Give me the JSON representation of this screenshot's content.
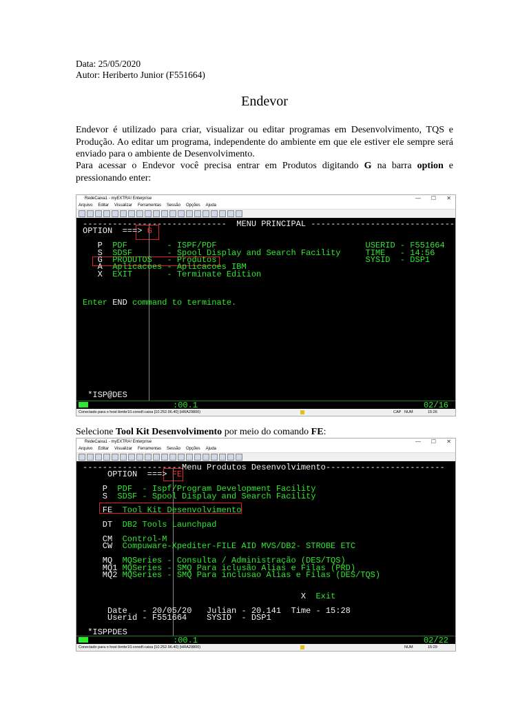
{
  "header": {
    "date": "Data: 25/05/2020",
    "author": "Autor: Heriberto Junior (F551664)"
  },
  "title": "Endevor",
  "intro": {
    "p1": "Endevor é utilizado para criar, visualizar ou editar programas em Desenvolvimento, TQS e Produção. Ao editar um programa, independente do ambiente em que ele estiver ele sempre será enviado para o ambiente de Desenvolvimento.",
    "p2_a": "Para acessar o Endevor você precisa entrar em Produtos digitando ",
    "p2_b": "G",
    "p2_c": " na barra ",
    "p2_d": "option",
    "p2_e": " e pressionando enter:"
  },
  "step2": {
    "a": "Selecione ",
    "b": "Tool Kit Desenvolvimento",
    "c": " por meio do comando ",
    "d": "FE",
    "e": ":"
  },
  "window": {
    "title": "RedeCaixa1 - myEXTRA! Enterprise",
    "menu": [
      "Arquivo",
      "Editar",
      "Visualizar",
      "Ferramentas",
      "Sessão",
      "Opções",
      "Ajuda"
    ],
    "minimize": "—",
    "maximize": "☐",
    "close": "✕"
  },
  "screen1": {
    "lines": [
      [
        [
          "-----------------------------  ",
          "w"
        ],
        [
          "MENU PRINCIPAL",
          "w"
        ],
        [
          " -----------------------------",
          "w"
        ]
      ],
      [
        [
          "OPTION  ===> ",
          "w"
        ],
        [
          "G",
          "r"
        ]
      ],
      [
        [
          "",
          "w"
        ]
      ],
      [
        [
          "   P  ",
          "w"
        ],
        [
          "PDF        - ISPF/PDF",
          "g"
        ],
        [
          "                              USERID - F551664",
          "g"
        ]
      ],
      [
        [
          "   S  ",
          "w"
        ],
        [
          "SDSF       - Spool Display and Search Facility",
          "g"
        ],
        [
          "     TIME   - 14:56",
          "g"
        ]
      ],
      [
        [
          "   G  ",
          "w"
        ],
        [
          "PRODUTOS   - Produtos",
          "g"
        ],
        [
          "                              SYSID  - DSP1",
          "g"
        ]
      ],
      [
        [
          "   A  ",
          "w"
        ],
        [
          "Aplicacoes - Aplicacoes IBM",
          "g"
        ]
      ],
      [
        [
          "   X  ",
          "w"
        ],
        [
          "EXIT       - Terminate Edition",
          "g"
        ]
      ],
      [
        [
          "",
          "w"
        ]
      ],
      [
        [
          "",
          "w"
        ]
      ],
      [
        [
          "",
          "w"
        ]
      ],
      [
        [
          "Enter ",
          "g"
        ],
        [
          "END",
          "w"
        ],
        [
          " command to terminate.",
          "g"
        ]
      ]
    ],
    "bottom_cmd": " *ISP@DES",
    "timer": ":00.1",
    "position": "02/16",
    "status_text": "Conectado para o host ibmbr10.coredf.caixa [10.252.96.40] (HRA29800)",
    "caps": "CAP",
    "num": "NUM",
    "clock": "15:26"
  },
  "screen2": {
    "lines": [
      [
        [
          "--------------------",
          "w"
        ],
        [
          "Menu Produtos Desenvolvimento",
          "w"
        ],
        [
          "------------------------",
          "w"
        ]
      ],
      [
        [
          "     OPTION  ===> ",
          "w"
        ],
        [
          "FE",
          "r"
        ]
      ],
      [
        [
          "",
          "w"
        ]
      ],
      [
        [
          "    P  ",
          "w"
        ],
        [
          "PDF  - Ispf/Program Development Facility",
          "g"
        ]
      ],
      [
        [
          "    S  ",
          "w"
        ],
        [
          "SDSF - Spool Display and Search Facility",
          "g"
        ]
      ],
      [
        [
          "",
          "w"
        ]
      ],
      [
        [
          "    FE  ",
          "w"
        ],
        [
          "Tool Kit Desenvolvimento",
          "g"
        ]
      ],
      [
        [
          "",
          "w"
        ]
      ],
      [
        [
          "    DT  ",
          "w"
        ],
        [
          "DB2 Tools Launchpad",
          "g"
        ]
      ],
      [
        [
          "",
          "w"
        ]
      ],
      [
        [
          "    CM  ",
          "w"
        ],
        [
          "Control-M",
          "g"
        ]
      ],
      [
        [
          "    CW  ",
          "w"
        ],
        [
          "Compuware-Xpediter-FILE AID MVS/DB2- STROBE ETC",
          "g"
        ]
      ],
      [
        [
          "",
          "w"
        ]
      ],
      [
        [
          "    MQ  ",
          "w"
        ],
        [
          "MQSeries - Consulta / Administração (DES/TQS)",
          "g"
        ]
      ],
      [
        [
          "    MQ1 ",
          "w"
        ],
        [
          "MQSeries - SMQ Para iclusão Alias e Filas (PRD)",
          "g"
        ]
      ],
      [
        [
          "    MQ2 ",
          "w"
        ],
        [
          "MQSeries - SMQ Para inclusao Alias e Filas (DES/TQS)",
          "g"
        ]
      ],
      [
        [
          "",
          "w"
        ]
      ],
      [
        [
          "",
          "w"
        ]
      ],
      [
        [
          "                                            X  ",
          "w"
        ],
        [
          "Exit",
          "g"
        ]
      ],
      [
        [
          "",
          "w"
        ]
      ],
      [
        [
          "     Date   - 20/05/20   Julian - 20.141  Time - 15:28",
          "w"
        ]
      ],
      [
        [
          "     Userid - F551664    SYSID  - DSP1",
          "w"
        ]
      ],
      [
        [
          "",
          "w"
        ]
      ],
      [
        [
          " *ISPPDES",
          "w"
        ]
      ]
    ],
    "timer": ":00.1",
    "position": "02/22",
    "status_text": "Conectado para o host ibmbr10.coredf.caixa [10.252.96.40] (HRA29800)",
    "num": "NUM",
    "clock": "15:29"
  }
}
